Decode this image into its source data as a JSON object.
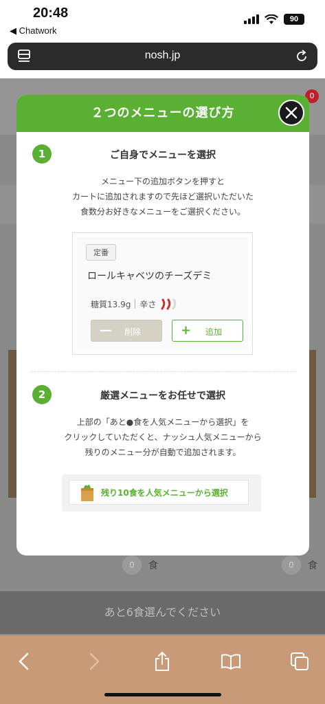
{
  "status": {
    "time": "20:48",
    "back_app": "◀ Chatwork",
    "battery": "90"
  },
  "browser": {
    "url": "nosh.jp"
  },
  "background": {
    "cart_count": "0",
    "food_count_left": "0",
    "food_count_right": "0",
    "food_unit": "食",
    "bottom_banner": "あと6食選んでください"
  },
  "modal": {
    "title": "２つのメニューの選び方",
    "step1": {
      "number": "1",
      "title": "ご自身でメニューを選択",
      "desc_lines": [
        "メニュー下の追加ボタンを押すと",
        "カートに追加されますので先ほど選択いただいた",
        "食数分お好きなメニューをご選択ください。"
      ],
      "card": {
        "tag": "定番",
        "menu_name": "ロールキャベツのチーズデミ",
        "carbs": "糖質13.9g",
        "spice_label": "辛さ",
        "delete_label": "削除",
        "add_label": "追加"
      }
    },
    "step2": {
      "number": "2",
      "title": "厳選メニューをお任せで選択",
      "desc_lines": [
        "上部の「あと●食を人気メニューから選択」を",
        "クリックしていただくと、ナッシュ人気メニューから",
        "残りのメニュー分が自動で追加されます。"
      ],
      "auto_button": "残り10食を人気メニューから選択"
    }
  },
  "colors": {
    "accent": "#5ab033",
    "badge": "#c0202a"
  }
}
